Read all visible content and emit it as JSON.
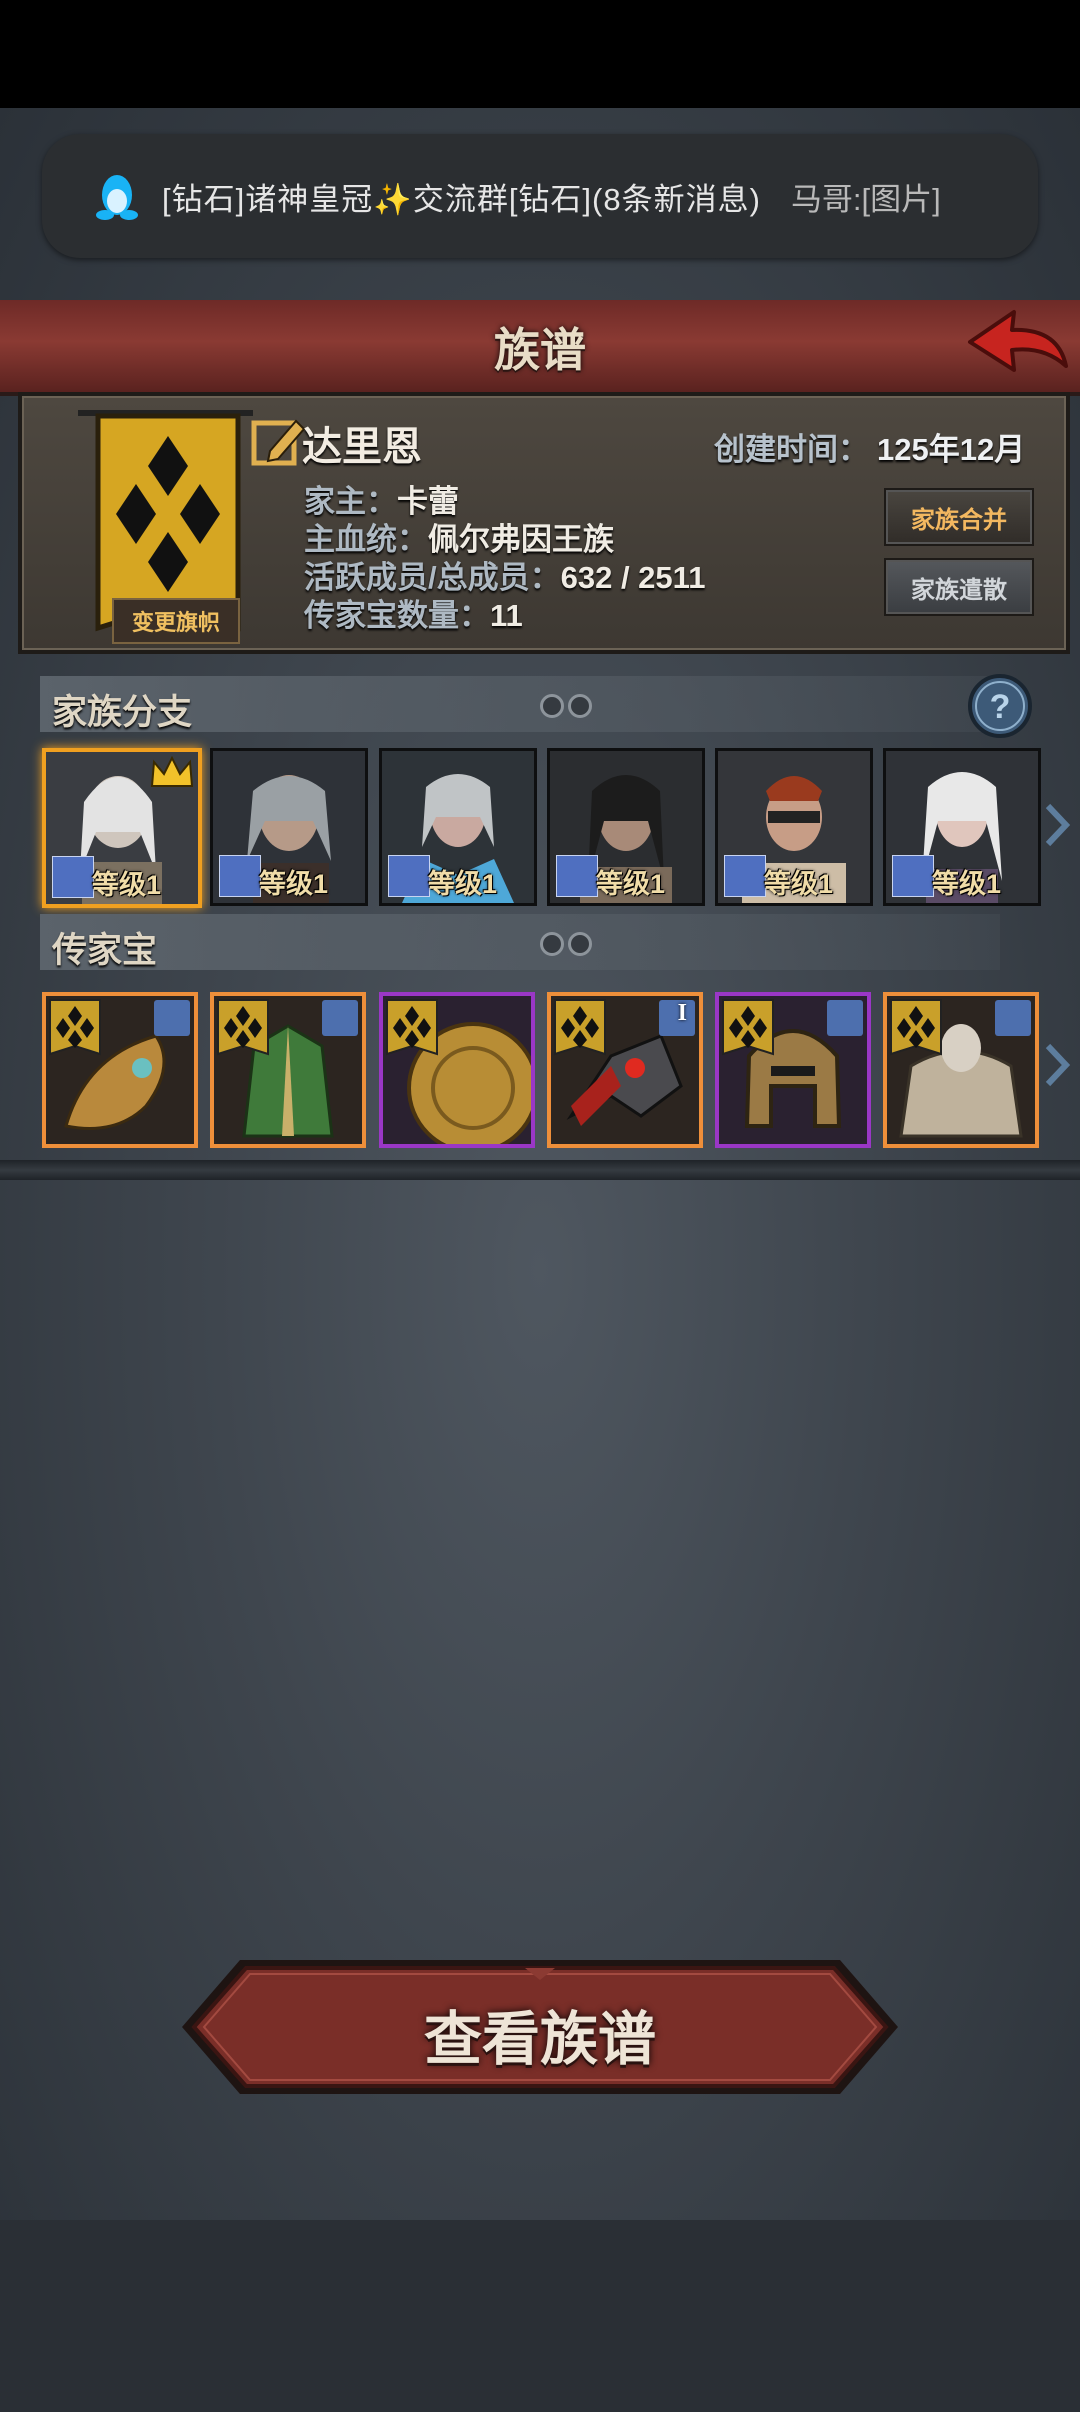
{
  "notification": {
    "title": "[钻石]诸神皇冠✨交流群[钻石](8条新消息)",
    "preview": "马哥:[图片]"
  },
  "header": {
    "title": "族谱"
  },
  "clan": {
    "name": "达里恩",
    "created_label": "创建时间：",
    "created_value": "125年12月",
    "leader_label": "家主：",
    "leader_value": "卡蕾",
    "bloodline_label": "主血统：",
    "bloodline_value": "佩尔弗因王族",
    "members_label": "活跃成员/总成员：",
    "members_value": "632 / 2511",
    "heirlooms_label": "传家宝数量：",
    "heirlooms_value": "11",
    "change_flag": "变更旗帜",
    "merge_button": "家族合并",
    "disband_button": "家族遣散"
  },
  "branches": {
    "title": "家族分支",
    "cards": [
      {
        "level": "等级1",
        "selected": true
      },
      {
        "level": "等级1",
        "selected": false
      },
      {
        "level": "等级1",
        "selected": false
      },
      {
        "level": "等级1",
        "selected": false
      },
      {
        "level": "等级1",
        "selected": false
      },
      {
        "level": "等级1",
        "selected": false
      }
    ]
  },
  "heirlooms": {
    "title": "传家宝",
    "items": [
      {
        "rarity": "orange",
        "icon": "golden-weapon-icon"
      },
      {
        "rarity": "orange",
        "icon": "green-armor-icon"
      },
      {
        "rarity": "purple",
        "icon": "golden-shield-icon"
      },
      {
        "rarity": "orange",
        "icon": "red-axe-icon",
        "badge": "I"
      },
      {
        "rarity": "purple",
        "icon": "helmet-icon"
      },
      {
        "rarity": "orange",
        "icon": "fur-armor-icon"
      }
    ]
  },
  "actions": {
    "view_tree": "查看族谱"
  },
  "colors": {
    "accent_orange": "#ee8f3a",
    "accent_purple": "#9a37c6",
    "header_red": "#7a302b",
    "highlight_gold": "#f0a020"
  }
}
